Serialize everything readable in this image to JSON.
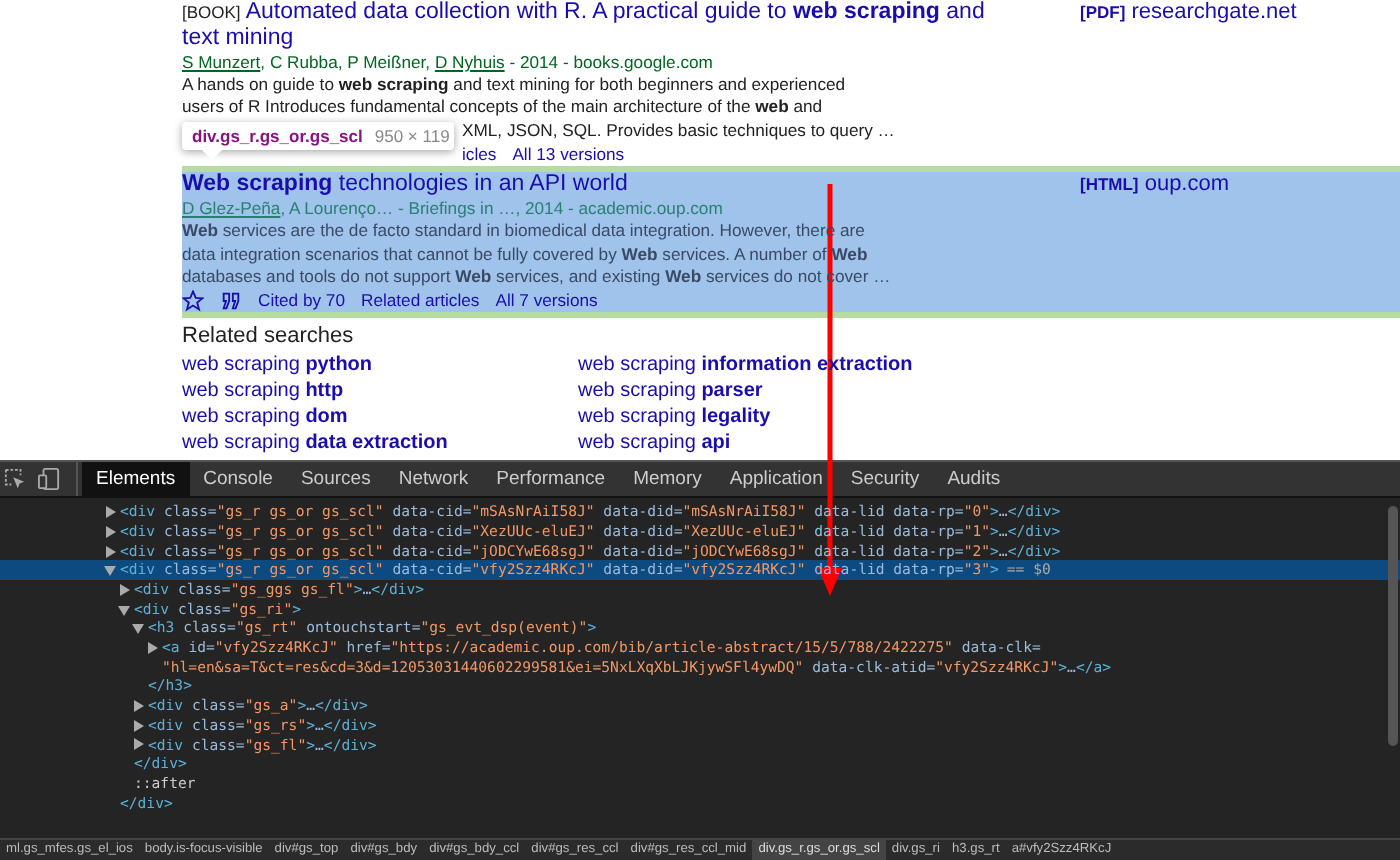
{
  "results": [
    {
      "highlighted": false,
      "title_tag": "[BOOK]",
      "title_lines": [
        "Automated data collection with R. A practical guide to **web scraping** and",
        "text mining"
      ],
      "byline": [
        {
          "text": "S Munzert",
          "linked": true
        },
        {
          "text": ", C Rubba, P Meißner, ",
          "linked": false
        },
        {
          "text": "D Nyhuis",
          "linked": true
        },
        {
          "text": " - 2014 - books.google.com",
          "linked": false
        }
      ],
      "snippet": [
        "A hands on guide to **web scraping** and text mining for both beginners and experienced",
        "users of R Introduces fundamental concepts of the main architecture of the **web** and",
        "XML, JSON, SQL. Provides basic techniques to query …"
      ],
      "inspect_tooltip": {
        "selector": "div.gs_r.gs_or.gs_scl",
        "size": "950 × 119"
      },
      "links": [
        "icles",
        "All 13 versions"
      ],
      "side": {
        "tag": "[PDF]",
        "site": "researchgate.net"
      }
    },
    {
      "highlighted": true,
      "title_lines": [
        "**Web scraping** technologies in an API world"
      ],
      "byline": [
        {
          "text": "D Glez-Peña",
          "linked": true
        },
        {
          "text": ", A Lourenço… - Briefings in …, 2014 - academic.oup.com",
          "linked": false
        }
      ],
      "snippet": [
        "**Web** services are the de facto standard in biomedical data integration. However, there are",
        "data integration scenarios that cannot be fully covered by **Web** services. A number of **Web**",
        "databases and tools do not support **Web** services, and existing **Web** services do not cover …"
      ],
      "actions": true,
      "links": [
        "Cited by 70",
        "Related articles",
        "All 7 versions"
      ],
      "side": {
        "tag": "[HTML]",
        "site": "oup.com"
      }
    }
  ],
  "related": {
    "heading": "Related searches",
    "items": [
      "web scraping **python**",
      "web scraping **information extraction**",
      "web scraping **http**",
      "web scraping **parser**",
      "web scraping **dom**",
      "web scraping **legality**",
      "web scraping **data extraction**",
      "web scraping **api**"
    ]
  },
  "devtools": {
    "tabs": [
      {
        "label": "Elements",
        "selected": true
      },
      {
        "label": "Console",
        "selected": false
      },
      {
        "label": "Sources",
        "selected": false
      },
      {
        "label": "Network",
        "selected": false
      },
      {
        "label": "Performance",
        "selected": false
      },
      {
        "label": "Memory",
        "selected": false
      },
      {
        "label": "Application",
        "selected": false
      },
      {
        "label": "Security",
        "selected": false
      },
      {
        "label": "Audits",
        "selected": false
      }
    ],
    "dom_tree": [
      {
        "kind": "element",
        "text": "<div class=\"gs_r gs_or gs_scl\" data-cid=\"mSAsNrAiI58J\" data-did=\"mSAsNrAiI58J\" data-lid data-rp=\"0\">…</div>",
        "expanded": false,
        "selected": false
      },
      {
        "kind": "element",
        "text": "<div class=\"gs_r gs_or gs_scl\" data-cid=\"XezUUc-eluEJ\" data-did=\"XezUUc-eluEJ\" data-lid data-rp=\"1\">…</div>",
        "expanded": false,
        "selected": false
      },
      {
        "kind": "element",
        "text": "<div class=\"gs_r gs_or gs_scl\" data-cid=\"jODCYwE68sgJ\" data-did=\"jODCYwE68sgJ\" data-lid data-rp=\"2\">…</div>",
        "expanded": false,
        "selected": false
      },
      {
        "kind": "element",
        "text": "<div class=\"gs_r gs_or gs_scl\" data-cid=\"vfy2Szz4RKcJ\" data-did=\"vfy2Szz4RKcJ\" data-lid data-rp=\"3\">",
        "marker": "== $0",
        "expanded": true,
        "selected": true,
        "close": "</div>",
        "children": [
          {
            "kind": "element",
            "text": "<div class=\"gs_ggs gs_fl\">…</div>",
            "expanded": false,
            "selected": false
          },
          {
            "kind": "element",
            "text": "<div class=\"gs_ri\">",
            "expanded": true,
            "selected": false,
            "close": "</div>",
            "children": [
              {
                "kind": "element",
                "text": "<h3 class=\"gs_rt\" ontouchstart=\"gs_evt_dsp(event)\">",
                "expanded": true,
                "selected": false,
                "close": "</h3>",
                "children": [
                  {
                    "kind": "element",
                    "text": "<a id=\"vfy2Szz4RKcJ\" href=\"https://academic.oup.com/bib/article-abstract/15/5/788/2422275\" data-clk=",
                    "continuation": "\"hl=en&sa=T&ct=res&cd=3&d=12053031440602299581&ei=5NxLXqXbLJKjywSFl4ywDQ\" data-clk-atid=\"vfy2Szz4RKcJ\">…</a>",
                    "expanded": false,
                    "selected": false
                  }
                ]
              },
              {
                "kind": "element",
                "text": "<div class=\"gs_a\">…</div>",
                "expanded": false,
                "selected": false
              },
              {
                "kind": "element",
                "text": "<div class=\"gs_rs\">…</div>",
                "expanded": false,
                "selected": false
              },
              {
                "kind": "element",
                "text": "<div class=\"gs_fl\">…</div>",
                "expanded": false,
                "selected": false
              }
            ]
          },
          {
            "kind": "pseudo",
            "text": "::after"
          }
        ]
      }
    ],
    "breadcrumbs": [
      {
        "label": "ml.gs_mfes.gs_el_ios",
        "selected": false
      },
      {
        "label": "body.is-focus-visible",
        "selected": false
      },
      {
        "label": "div#gs_top",
        "selected": false
      },
      {
        "label": "div#gs_bdy",
        "selected": false
      },
      {
        "label": "div#gs_bdy_ccl",
        "selected": false
      },
      {
        "label": "div#gs_res_ccl",
        "selected": false
      },
      {
        "label": "div#gs_res_ccl_mid",
        "selected": false
      },
      {
        "label": "div.gs_r.gs_or.gs_scl",
        "selected": true
      },
      {
        "label": "div.gs_ri",
        "selected": false
      },
      {
        "label": "h3.gs_rt",
        "selected": false
      },
      {
        "label": "a#vfy2Szz4RKcJ",
        "selected": false
      }
    ]
  }
}
